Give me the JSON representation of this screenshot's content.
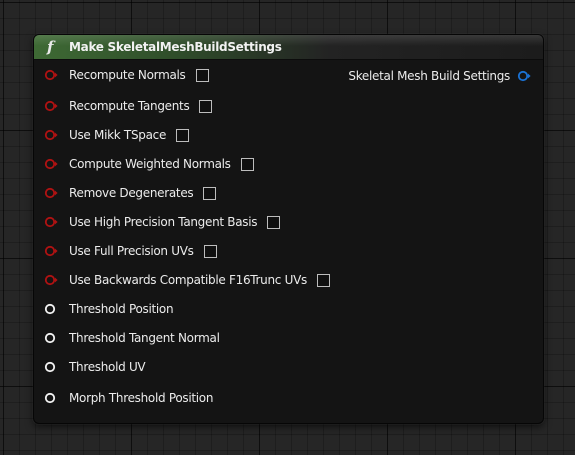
{
  "node": {
    "title": "Make SkeletalMeshBuildSettings",
    "icon": "function-icon",
    "icon_glyph": "f",
    "header_color": "#3e6a34"
  },
  "inputs": [
    {
      "label": "Recompute Normals",
      "type": "bool",
      "checked": false
    },
    {
      "label": "Recompute Tangents",
      "type": "bool",
      "checked": false
    },
    {
      "label": "Use Mikk TSpace",
      "type": "bool",
      "checked": false
    },
    {
      "label": "Compute Weighted Normals",
      "type": "bool",
      "checked": false
    },
    {
      "label": "Remove Degenerates",
      "type": "bool",
      "checked": false
    },
    {
      "label": "Use High Precision Tangent Basis",
      "type": "bool",
      "checked": false
    },
    {
      "label": "Use Full Precision UVs",
      "type": "bool",
      "checked": false
    },
    {
      "label": "Use Backwards Compatible F16Trunc UVs",
      "type": "bool",
      "checked": false
    },
    {
      "label": "Threshold Position",
      "type": "float"
    },
    {
      "label": "Threshold Tangent Normal",
      "type": "float"
    },
    {
      "label": "Threshold UV",
      "type": "float"
    },
    {
      "label": "Morph Threshold Position",
      "type": "float"
    }
  ],
  "output": {
    "label": "Skeletal Mesh Build Settings",
    "type": "struct"
  },
  "colors": {
    "bool_pin": "#b01212",
    "float_pin": "#f2f2f2",
    "struct_pin": "#1a72d4",
    "canvas": "#262626",
    "node_body": "#141414"
  }
}
